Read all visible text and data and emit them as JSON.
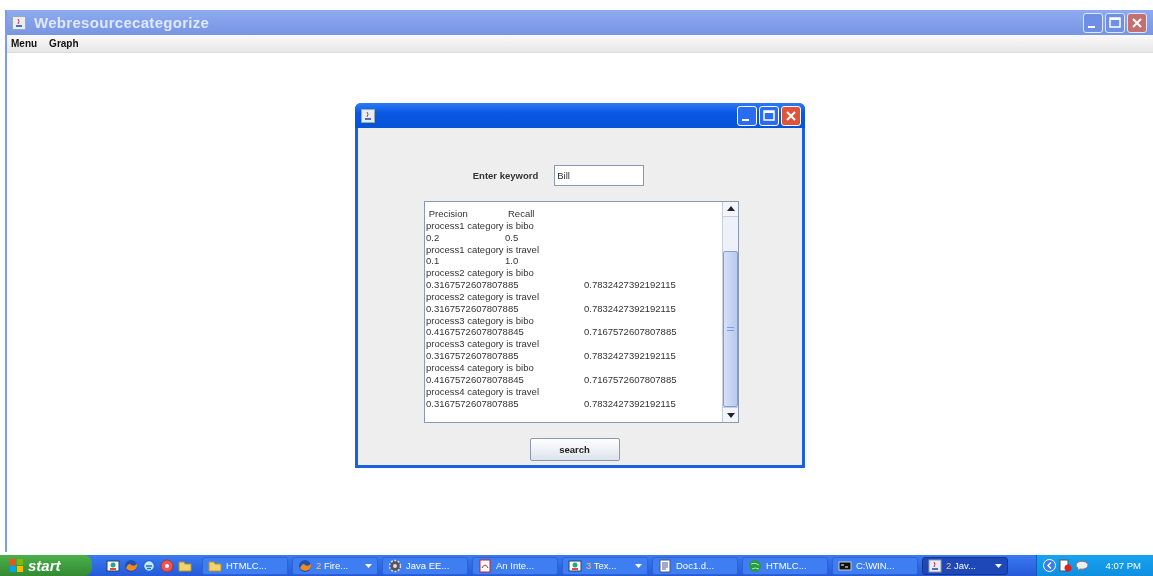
{
  "window": {
    "title": "Webresourcecategorize"
  },
  "menu": [
    "Menu",
    "Graph"
  ],
  "dialog": {
    "keyword_label": "Enter keyword",
    "keyword_value": "Bill",
    "output_lines": [
      " Precision\tRecall",
      "process1 category is bibo",
      "0.2\t0.5",
      "process1 category is travel",
      "0.1\t1.0",
      "process2 category is bibo",
      "0.3167572607807885\t0.7832427392192115",
      "process2 category is travel",
      "0.3167572607807885\t0.7832427392192115",
      "process3 category is bibo",
      "0.41675726078078845\t0.7167572607807885",
      "process3 category is travel",
      "0.3167572607807885\t0.7832427392192115",
      "process4 category is bibo",
      "0.41675726078078845\t0.7167572607807885",
      "process4 category is travel",
      "0.3167572607807885\t0.7832427392192115"
    ],
    "button": "search"
  },
  "taskbar": {
    "start": "start",
    "quick_launch": [
      {
        "kind": "messenger"
      },
      {
        "kind": "browser"
      },
      {
        "kind": "ie"
      },
      {
        "kind": "media"
      },
      {
        "kind": "folder"
      }
    ],
    "tasks": [
      {
        "kind": "folder",
        "label": "HTMLC...",
        "group": false,
        "selected": false
      },
      {
        "kind": "browser",
        "count": "2",
        "label": "Fire...",
        "group": true,
        "selected": false
      },
      {
        "kind": "gear",
        "label": "Java EE...",
        "group": false,
        "selected": false
      },
      {
        "kind": "pdf",
        "label": "An Inte...",
        "group": false,
        "selected": false
      },
      {
        "kind": "messenger",
        "count": "3",
        "label": "Tex...",
        "group": true,
        "selected": false
      },
      {
        "kind": "document",
        "label": "Doc1.d...",
        "group": false,
        "selected": false
      },
      {
        "kind": "globe",
        "label": "HTMLC...",
        "group": false,
        "selected": false
      },
      {
        "kind": "console",
        "label": "C:\\WIN...",
        "group": false,
        "selected": false
      },
      {
        "kind": "java",
        "count": "2",
        "label": "Jav...",
        "group": true,
        "selected": true
      }
    ],
    "clock": "4:07 PM"
  }
}
